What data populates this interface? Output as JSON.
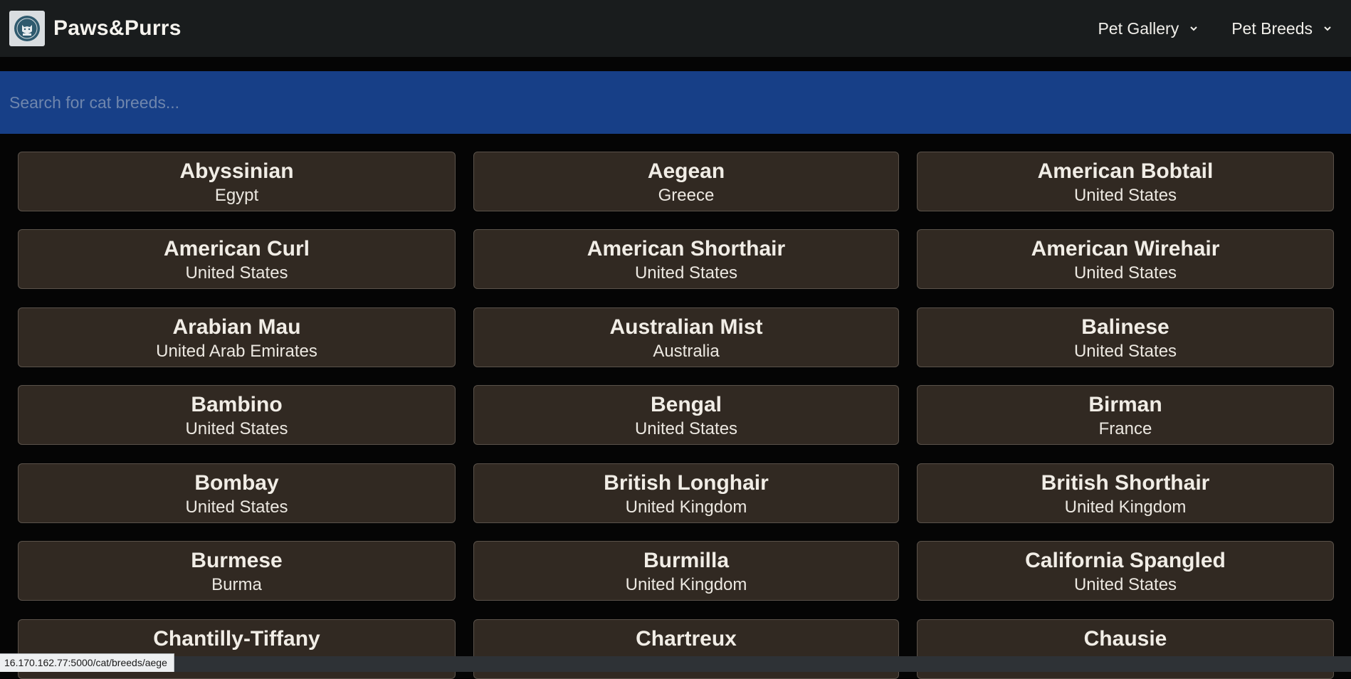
{
  "brand": {
    "name": "Paws&Purrs",
    "logo_icon": "cat-logo-icon"
  },
  "nav": [
    {
      "label": "Pet Gallery",
      "icon": "chevron-down-icon"
    },
    {
      "label": "Pet Breeds",
      "icon": "chevron-down-icon"
    }
  ],
  "search": {
    "placeholder": "Search for cat breeds...",
    "value": ""
  },
  "breeds": [
    {
      "name": "Abyssinian",
      "origin": "Egypt"
    },
    {
      "name": "Aegean",
      "origin": "Greece"
    },
    {
      "name": "American Bobtail",
      "origin": "United States"
    },
    {
      "name": "American Curl",
      "origin": "United States"
    },
    {
      "name": "American Shorthair",
      "origin": "United States"
    },
    {
      "name": "American Wirehair",
      "origin": "United States"
    },
    {
      "name": "Arabian Mau",
      "origin": "United Arab Emirates"
    },
    {
      "name": "Australian Mist",
      "origin": "Australia"
    },
    {
      "name": "Balinese",
      "origin": "United States"
    },
    {
      "name": "Bambino",
      "origin": "United States"
    },
    {
      "name": "Bengal",
      "origin": "United States"
    },
    {
      "name": "Birman",
      "origin": "France"
    },
    {
      "name": "Bombay",
      "origin": "United States"
    },
    {
      "name": "British Longhair",
      "origin": "United Kingdom"
    },
    {
      "name": "British Shorthair",
      "origin": "United Kingdom"
    },
    {
      "name": "Burmese",
      "origin": "Burma"
    },
    {
      "name": "Burmilla",
      "origin": "United Kingdom"
    },
    {
      "name": "California Spangled",
      "origin": "United States"
    },
    {
      "name": "Chantilly-Tiffany",
      "origin": ""
    },
    {
      "name": "Chartreux",
      "origin": ""
    },
    {
      "name": "Chausie",
      "origin": ""
    }
  ],
  "status_bar": {
    "url": "16.170.162.77:5000/cat/breeds/aege"
  },
  "colors": {
    "navbar": "#191c1d",
    "search_bar": "#173f87",
    "card_bg": "#312922",
    "page_bg": "#050505"
  }
}
